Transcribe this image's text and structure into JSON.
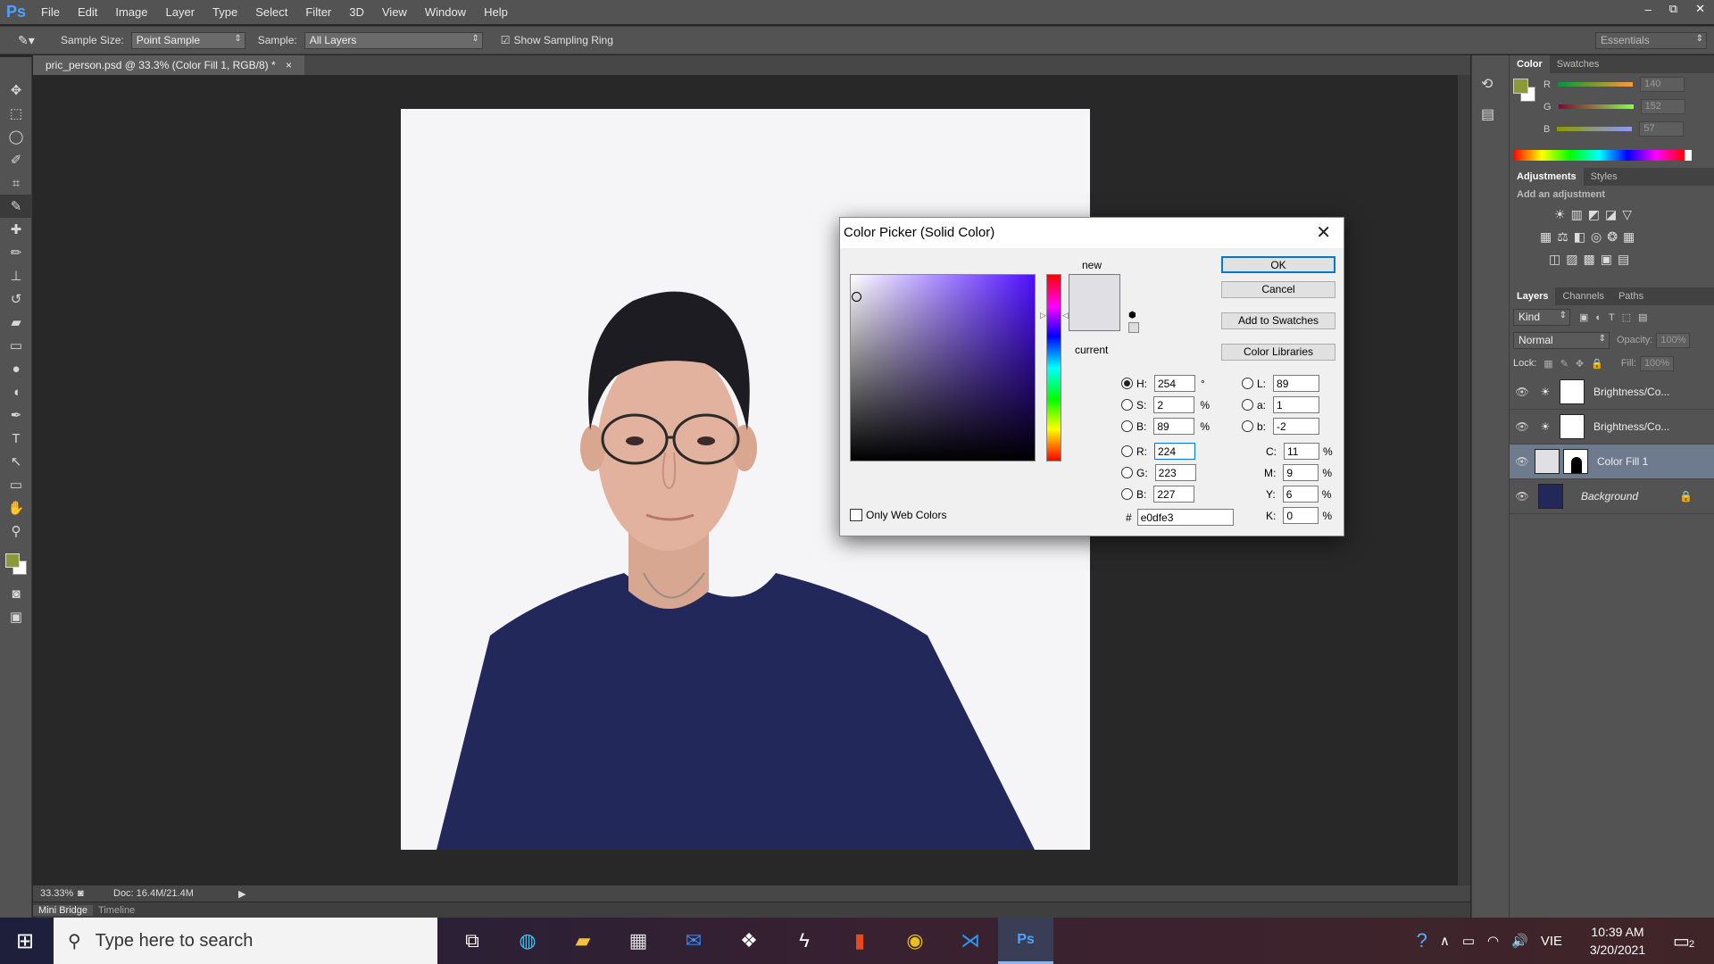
{
  "app": {
    "logo": "Ps"
  },
  "menu": [
    "File",
    "Edit",
    "Image",
    "Layer",
    "Type",
    "Select",
    "Filter",
    "3D",
    "View",
    "Window",
    "Help"
  ],
  "window_controls": [
    "–",
    "⧉",
    "✕"
  ],
  "options_bar": {
    "sample_size_label": "Sample Size:",
    "sample_size_value": "Point Sample",
    "sample_label": "Sample:",
    "sample_value": "All Layers",
    "sampling_ring_label": "Show Sampling Ring",
    "workspace": "Essentials"
  },
  "document": {
    "tab_title": "pric_person.psd @ 33.3% (Color Fill 1, RGB/8) *",
    "zoom": "33.33%",
    "doc_size": "Doc: 16.4M/21.4M"
  },
  "bottom_tabs": [
    "Mini Bridge",
    "Timeline"
  ],
  "color_panel": {
    "tabs": [
      "Color",
      "Swatches"
    ],
    "r_label": "R",
    "r_value": "140",
    "g_label": "G",
    "g_value": "152",
    "b_label": "B",
    "b_value": "57",
    "foreground": "#8c9839"
  },
  "adjustments_panel": {
    "tabs": [
      "Adjustments",
      "Styles"
    ],
    "hint": "Add an adjustment"
  },
  "layers_panel": {
    "tabs": [
      "Layers",
      "Channels",
      "Paths"
    ],
    "kind": "Kind",
    "blend": "Normal",
    "opacity_label": "Opacity:",
    "opacity": "100%",
    "lock_label": "Lock:",
    "fill_label": "Fill:",
    "fill": "100%",
    "layers": [
      {
        "name": "Brightness/Co..."
      },
      {
        "name": "Brightness/Co..."
      },
      {
        "name": "Color Fill 1"
      },
      {
        "name": "Background"
      }
    ]
  },
  "color_picker": {
    "title": "Color Picker (Solid Color)",
    "new_label": "new",
    "current_label": "current",
    "new_color": "#e0dfe3",
    "current_color": "#e0dfe3",
    "ok": "OK",
    "cancel": "Cancel",
    "add_to_swatches": "Add to Swatches",
    "color_libraries": "Color Libraries",
    "only_web_colors": "Only Web Colors",
    "hue_base_color": "#4e10ff",
    "fields": {
      "H": "254",
      "S": "2",
      "B": "89",
      "R": "224",
      "G": "223",
      "Bv": "227",
      "L": "89",
      "a": "1",
      "b": "-2",
      "C": "11",
      "M": "9",
      "Y": "6",
      "K": "0"
    },
    "units": {
      "deg": "°",
      "pct": "%"
    },
    "hex_label": "#",
    "hex": "e0dfe3"
  },
  "taskbar": {
    "search_placeholder": "Type here to search",
    "language": "VIE",
    "time": "10:39 AM",
    "date": "3/20/2021",
    "notification_count": "2"
  }
}
